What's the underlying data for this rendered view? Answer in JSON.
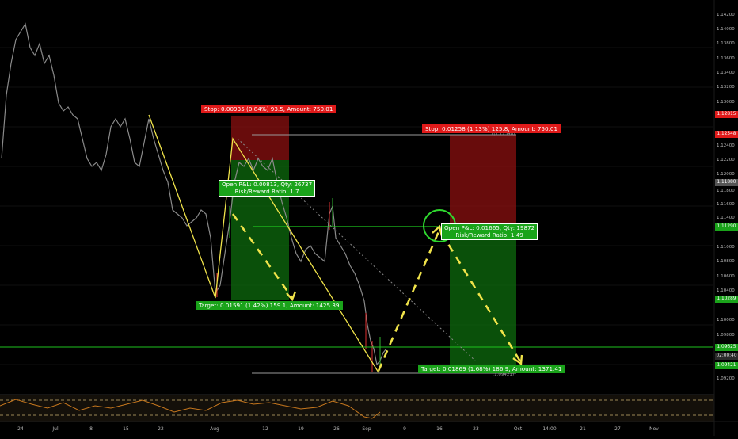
{
  "chart": {
    "instrument_axis": "price",
    "y_axis_ticks": [
      "1.14200",
      "1.14000",
      "1.13800",
      "1.13600",
      "1.13400",
      "1.13200",
      "1.13000",
      "1.12400",
      "1.12200",
      "1.12000",
      "1.11800",
      "1.11600",
      "1.11400",
      "1.11000",
      "1.10800",
      "1.10600",
      "1.10400",
      "1.10000",
      "1.09800",
      "1.09200"
    ],
    "x_axis_ticks": [
      "24",
      "Jul",
      "8",
      "15",
      "22",
      "Aug",
      "12",
      "19",
      "26",
      "Sep",
      "9",
      "16",
      "23",
      "Oct",
      "14:00",
      "21",
      "27",
      "Nov"
    ],
    "price_labels": [
      {
        "text": "1.12815",
        "color": "#e01a1a"
      },
      {
        "text": "1.12548",
        "color": "#e01a1a"
      },
      {
        "text": "1.11880",
        "color": "#555555"
      },
      {
        "text": "1.11290",
        "color": "#1aa31a"
      },
      {
        "text": "1.10289",
        "color": "#1aa31a"
      },
      {
        "text": "1.09625",
        "color": "#1aa31a"
      },
      {
        "text": "02:00:40",
        "color": "#2a2a2a"
      },
      {
        "text": "1.09421",
        "color": "#1aa31a"
      }
    ],
    "marker_labels": [
      "T(1.12548)",
      "(1.09421)"
    ]
  },
  "trade1": {
    "stop_label": "Stop: 0.00935 (0.84%) 93.5, Amount: 750.01",
    "target_label": "Target: 0.01591 (1.42%) 159.1, Amount: 1425.39",
    "pnl_line1": "Open P&L: 0.00813, Qty: 26737",
    "pnl_line2": "Risk/Reward Ratio: 1.7"
  },
  "trade2": {
    "stop_label": "Stop: 0.01258 (1.13%) 125.8, Amount: 750.01",
    "target_label": "Target: 0.01869 (1.68%) 186.9, Amount: 1371.41",
    "pnl_line1": "Open P&L: 0.01665, Qty: 19872",
    "pnl_line2": "Risk/Reward Ratio: 1.49"
  },
  "colors": {
    "background": "#000000",
    "stop_zone": "#8b1010",
    "target_zone": "#0d6b0d",
    "pattern_line": "#f0e34a",
    "level_line": "#1ec21e",
    "oscillator": "#c8781e"
  }
}
